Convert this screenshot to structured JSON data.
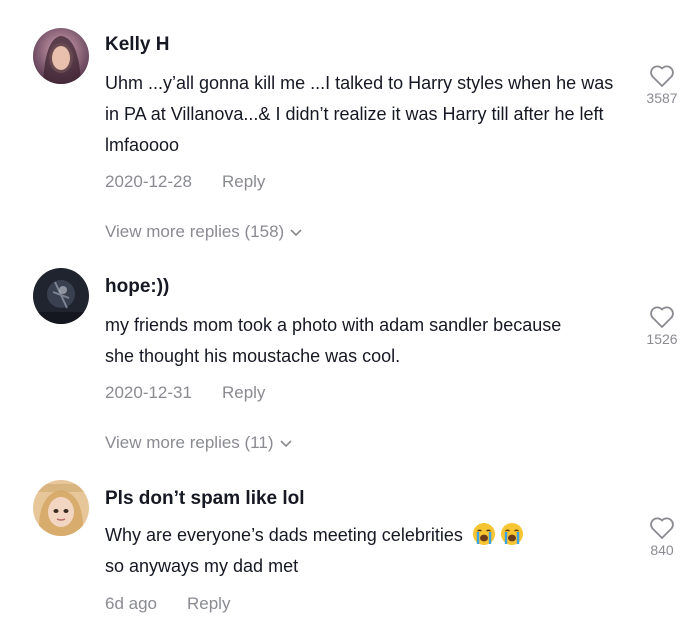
{
  "comments": [
    {
      "username": "Kelly H",
      "text": "Uhm ...y’all gonna kill me ...I talked to Harry styles when he was in PA at Villanova...& I didn’t realize it was Harry till after he left lmfaoooo",
      "date": "2020-12-28",
      "reply_label": "Reply",
      "view_more": "View more replies (158)",
      "likes": "3587",
      "avatar_colors": [
        "#5a3a52",
        "#c98fa6"
      ]
    },
    {
      "username": "hope:))",
      "text": "my friends mom took a photo with adam sandler because she thought his moustache was cool.",
      "date": "2020-12-31",
      "reply_label": "Reply",
      "view_more": "View more replies (11)",
      "likes": "1526",
      "avatar_colors": [
        "#1b1f2a",
        "#6a7284"
      ]
    },
    {
      "username": "Pls don’t spam like lol",
      "text_line1": "Why are everyone’s dads meeting celebrities",
      "text_line2": "so anyways my dad met",
      "emoji_name": "loudly-crying-face-emoji",
      "date": "6d ago",
      "reply_label": "Reply",
      "likes": "840",
      "avatar_colors": [
        "#e9c98e",
        "#c9a06a"
      ]
    }
  ],
  "colors": {
    "text_primary": "#161823",
    "text_secondary": "#8a8b91"
  }
}
